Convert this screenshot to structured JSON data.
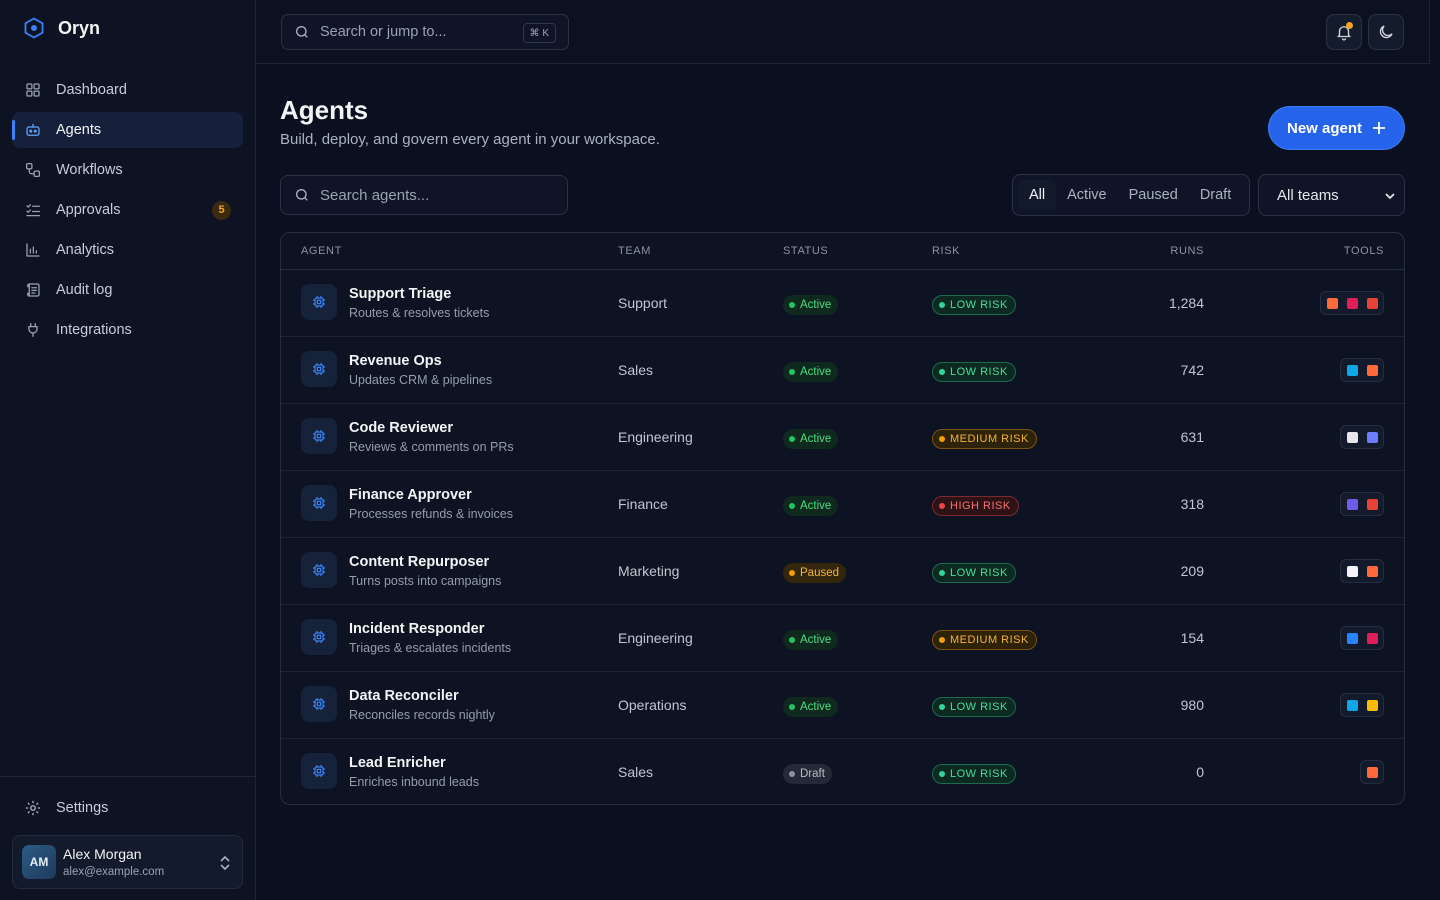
{
  "brand": {
    "name": "Oryn"
  },
  "nav": [
    {
      "label": "Dashboard",
      "icon": "dashboard-icon"
    },
    {
      "label": "Agents",
      "icon": "bot-icon",
      "active": true
    },
    {
      "label": "Workflows",
      "icon": "workflow-icon"
    },
    {
      "label": "Approvals",
      "icon": "checklist-icon",
      "badge": "5"
    },
    {
      "label": "Analytics",
      "icon": "bar-chart-icon"
    },
    {
      "label": "Audit log",
      "icon": "scroll-icon"
    },
    {
      "label": "Integrations",
      "icon": "plug-icon"
    }
  ],
  "settings_label": "Settings",
  "user": {
    "initials": "AM",
    "name": "Alex Morgan",
    "email": "alex@example.com"
  },
  "topbar": {
    "search_placeholder": "Search or jump to...",
    "shortcut": "⌘ K"
  },
  "page": {
    "title": "Agents",
    "subtitle": "Build, deploy, and govern every agent in your workspace.",
    "new_agent_label": "New agent"
  },
  "filters": {
    "search_placeholder": "Search agents...",
    "segments": [
      "All",
      "Active",
      "Paused",
      "Draft"
    ],
    "selected_segment": "All",
    "team_select": "All teams"
  },
  "table": {
    "columns": [
      "AGENT",
      "TEAM",
      "STATUS",
      "RISK",
      "RUNS",
      "TOOLS"
    ],
    "rows": [
      {
        "name": "Support Triage",
        "desc": "Routes & resolves tickets",
        "team": "Support",
        "status": "Active",
        "risk": "LOW RISK",
        "runs": "1,284",
        "tools": [
          "hubspot",
          "slack",
          "gmail"
        ]
      },
      {
        "name": "Revenue Ops",
        "desc": "Updates CRM & pipelines",
        "team": "Sales",
        "status": "Active",
        "risk": "LOW RISK",
        "runs": "742",
        "tools": [
          "salesforce",
          "hubspot"
        ]
      },
      {
        "name": "Code Reviewer",
        "desc": "Reviews & comments on PRs",
        "team": "Engineering",
        "status": "Active",
        "risk": "MEDIUM RISK",
        "runs": "631",
        "tools": [
          "github",
          "linear"
        ]
      },
      {
        "name": "Finance Approver",
        "desc": "Processes refunds & invoices",
        "team": "Finance",
        "status": "Active",
        "risk": "HIGH RISK",
        "runs": "318",
        "tools": [
          "stripe",
          "gmail"
        ]
      },
      {
        "name": "Content Repurposer",
        "desc": "Turns posts into campaigns",
        "team": "Marketing",
        "status": "Paused",
        "risk": "LOW RISK",
        "runs": "209",
        "tools": [
          "notion",
          "hubspot"
        ]
      },
      {
        "name": "Incident Responder",
        "desc": "Triages & escalates incidents",
        "team": "Engineering",
        "status": "Active",
        "risk": "MEDIUM RISK",
        "runs": "154",
        "tools": [
          "jira",
          "slack"
        ]
      },
      {
        "name": "Data Reconciler",
        "desc": "Reconciles records nightly",
        "team": "Operations",
        "status": "Active",
        "risk": "LOW RISK",
        "runs": "980",
        "tools": [
          "salesforce",
          "google-drive"
        ]
      },
      {
        "name": "Lead Enricher",
        "desc": "Enriches inbound leads",
        "team": "Sales",
        "status": "Draft",
        "risk": "LOW RISK",
        "runs": "0",
        "tools": [
          "hubspot"
        ]
      }
    ]
  },
  "colors": {
    "accent": "#2563eb",
    "background": "#0b1020",
    "sidebar": "#0d1322"
  }
}
